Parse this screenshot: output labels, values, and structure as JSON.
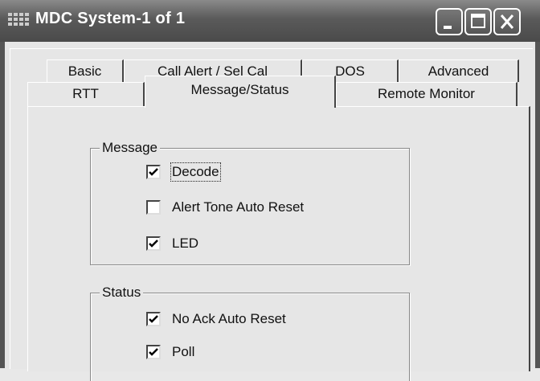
{
  "window": {
    "title": "MDC System-1 of 1"
  },
  "tabs": {
    "row1": [
      {
        "label": "Basic"
      },
      {
        "label": "Call Alert / Sel Cal"
      },
      {
        "label": "DOS"
      },
      {
        "label": "Advanced"
      }
    ],
    "row2": [
      {
        "label": "RTT"
      },
      {
        "label": "Message/Status",
        "selected": true
      },
      {
        "label": "Remote Monitor"
      }
    ]
  },
  "message_group": {
    "title": "Message",
    "options": [
      {
        "label": "Decode",
        "checked": true,
        "focused": true
      },
      {
        "label": "Alert Tone Auto Reset",
        "checked": false
      },
      {
        "label": "LED",
        "checked": true
      }
    ]
  },
  "status_group": {
    "title": "Status",
    "options": [
      {
        "label": "No Ack Auto Reset",
        "checked": true
      },
      {
        "label": "Poll",
        "checked": true
      }
    ]
  }
}
